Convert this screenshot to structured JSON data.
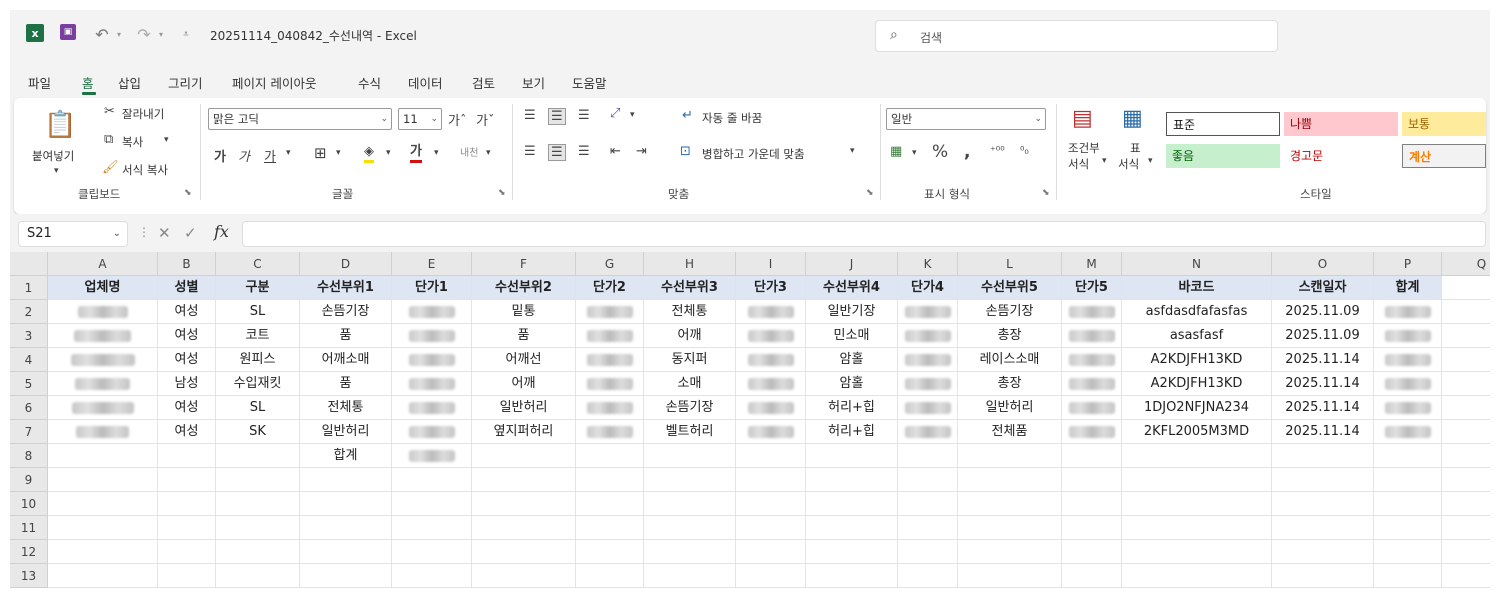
{
  "titlebar": {
    "logo": "x",
    "doc_title": "20251114_040842_수선내역  -  Excel",
    "search_placeholder": "검색"
  },
  "menu": [
    "파일",
    "홈",
    "삽입",
    "그리기",
    "페이지 레이아웃",
    "수식",
    "데이터",
    "검토",
    "보기",
    "도움말"
  ],
  "ribbon": {
    "clipboard": {
      "paste": "붙여넣기",
      "cut": "잘라내기",
      "copy": "복사",
      "format_painter": "서식 복사",
      "group": "클립보드"
    },
    "font": {
      "name": "맑은 고딕",
      "size": "11",
      "group": "글꼴"
    },
    "alignment": {
      "wrap": "자동 줄 바꿈",
      "merge": "병합하고 가운데 맞춤",
      "group": "맞춤"
    },
    "number": {
      "format": "일반",
      "group": "표시 형식"
    },
    "styles": {
      "conditional": [
        "조건부",
        "서식"
      ],
      "table": [
        "표",
        "서식"
      ],
      "cells": [
        "표준",
        "나쁨",
        "보통",
        "좋음",
        "경고문",
        "계산"
      ],
      "group": "스타일"
    }
  },
  "formula_bar": {
    "name_box": "S21",
    "value": ""
  },
  "columns": [
    "A",
    "B",
    "C",
    "D",
    "E",
    "F",
    "G",
    "H",
    "I",
    "J",
    "K",
    "L",
    "M",
    "N",
    "O",
    "P",
    "Q"
  ],
  "rows": [
    "1",
    "2",
    "3",
    "4",
    "5",
    "6",
    "7",
    "8",
    "9",
    "10",
    "11",
    "12",
    "13"
  ],
  "header_row": [
    "업체명",
    "성별",
    "구분",
    "수선부위1",
    "단가1",
    "수선부위2",
    "단가2",
    "수선부위3",
    "단가3",
    "수선부위4",
    "단가4",
    "수선부위5",
    "단가5",
    "바코드",
    "스캔일자",
    "합계"
  ],
  "data_rows": [
    [
      "",
      "여성",
      "SL",
      "손뜸기장",
      "",
      "밑통",
      "",
      "전체통",
      "",
      "일반기장",
      "",
      "손뜸기장",
      "",
      "asfdasdfafasfas",
      "2025.11.09",
      ""
    ],
    [
      "",
      "여성",
      "코트",
      "품",
      "",
      "품",
      "",
      "어깨",
      "",
      "민소매",
      "",
      "총장",
      "",
      "asasfasf",
      "2025.11.09",
      ""
    ],
    [
      "",
      "여성",
      "원피스",
      "어깨소매",
      "",
      "어깨선",
      "",
      "동지퍼",
      "",
      "암홀",
      "",
      "레이스소매",
      "",
      "A2KDJFH13KD",
      "2025.11.14",
      ""
    ],
    [
      "",
      "남성",
      "수입재킷",
      "품",
      "",
      "어깨",
      "",
      "소매",
      "",
      "암홀",
      "",
      "총장",
      "",
      "A2KDJFH13KD",
      "2025.11.14",
      ""
    ],
    [
      "",
      "여성",
      "SL",
      "전체통",
      "",
      "일반허리",
      "",
      "손뜸기장",
      "",
      "허리+힙",
      "",
      "일반허리",
      "",
      "1DJO2NFJNA234",
      "2025.11.14",
      ""
    ],
    [
      "",
      "여성",
      "SK",
      "일반허리",
      "",
      "옆지퍼허리",
      "",
      "벨트허리",
      "",
      "허리+힙",
      "",
      "전체품",
      "",
      "2KFL2005M3MD",
      "2025.11.14",
      ""
    ],
    [
      "",
      "",
      "",
      "합계",
      "",
      "",
      "",
      "",
      "",
      "",
      "",
      "",
      "",
      "",
      "",
      ""
    ]
  ]
}
